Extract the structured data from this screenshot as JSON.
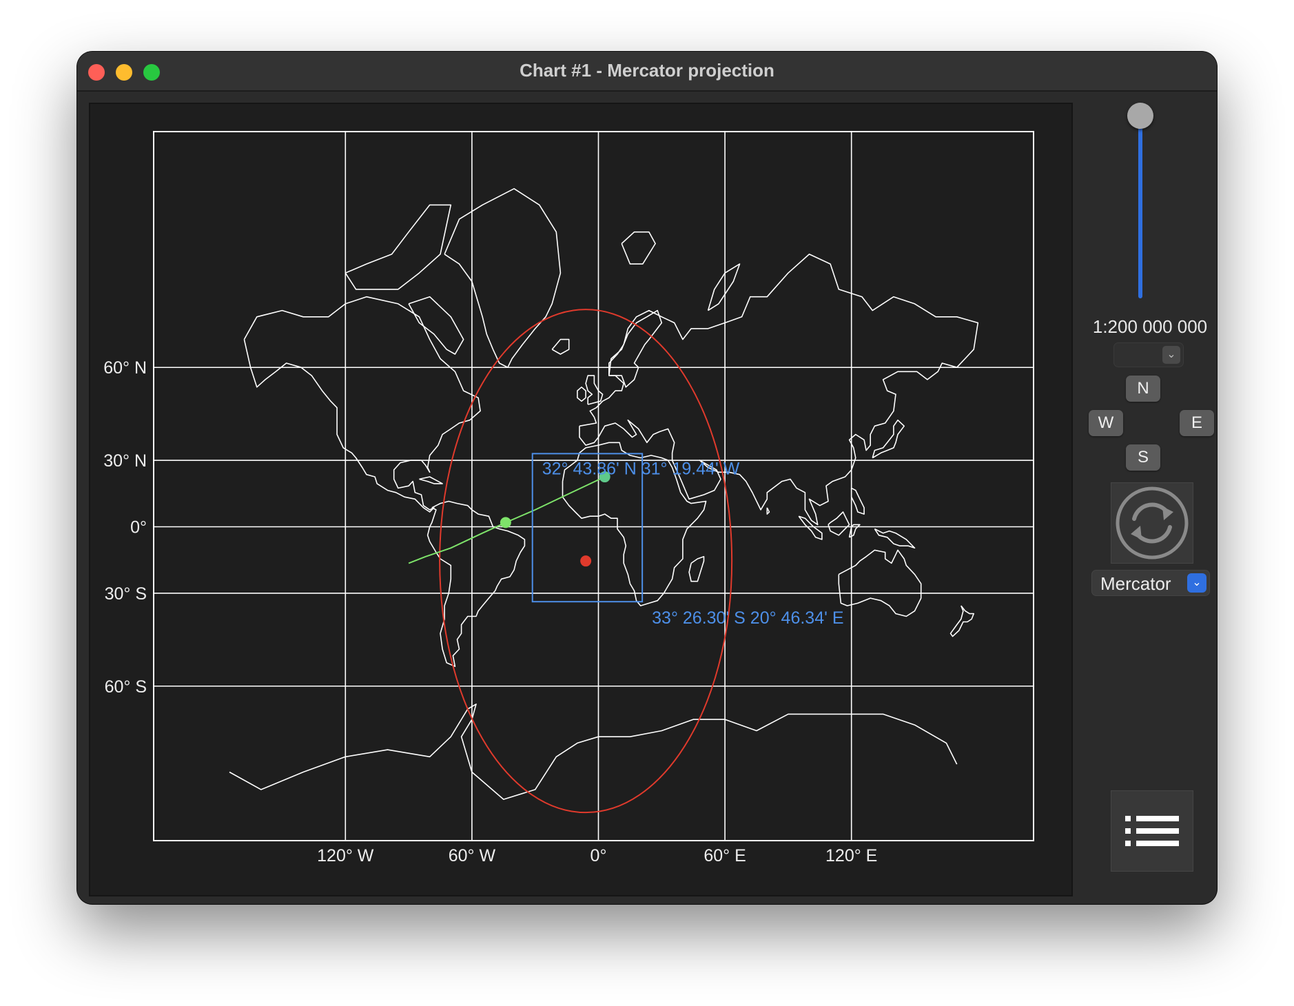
{
  "window": {
    "title": "Chart #1 - Mercator projection"
  },
  "map": {
    "projection": "Mercator",
    "lat_labels": [
      {
        "lat": 60,
        "text": "60° N"
      },
      {
        "lat": 30,
        "text": "30° N"
      },
      {
        "lat": 0,
        "text": "0°"
      },
      {
        "lat": -30,
        "text": "30° S"
      },
      {
        "lat": -60,
        "text": "60° S"
      }
    ],
    "lon_labels": [
      {
        "lon": -120,
        "text": "120° W"
      },
      {
        "lon": -60,
        "text": "60° W"
      },
      {
        "lon": 0,
        "text": "0°"
      },
      {
        "lon": 60,
        "text": "60° E"
      },
      {
        "lon": 120,
        "text": "120° E"
      }
    ],
    "selection": {
      "corner_nw_label": "32° 43.86' N  31° 19.44' W",
      "corner_se_label": "33° 26.30' S  20° 46.34' E"
    },
    "colors": {
      "background": "#1e1e1e",
      "grid": "#ffffff",
      "coastline": "#ffffff",
      "selection": "#4d8fe8",
      "circle": "#e03a2c",
      "track": "#7ee36a"
    }
  },
  "controls": {
    "scale_label": "1:200 000 000",
    "scale_select_value": "",
    "nav": {
      "north": "N",
      "west": "W",
      "east": "E",
      "south": "S"
    },
    "projection_select": "Mercator",
    "refresh_icon": "refresh-icon",
    "list_icon": "list-icon"
  }
}
